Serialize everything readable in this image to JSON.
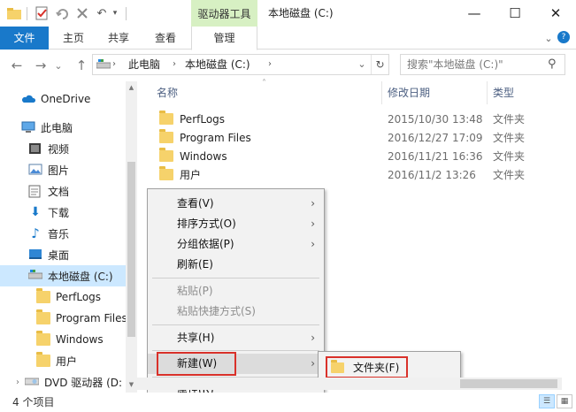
{
  "window": {
    "title": "本地磁盘 (C:)",
    "context_tab_group": "驱动器工具",
    "minimize_glyph": "—",
    "maximize_glyph": "☐",
    "close_glyph": "✕"
  },
  "quick_access": {
    "undo_glyph": "↶",
    "more_glyph": "▾"
  },
  "ribbon": {
    "tabs": [
      "文件",
      "主页",
      "共享",
      "查看",
      "管理"
    ],
    "collapse_glyph": "⌄",
    "help_glyph": "?"
  },
  "address_bar": {
    "back_glyph": "←",
    "forward_glyph": "→",
    "recent_glyph": "⌄",
    "up_glyph": "↑",
    "crumbs": [
      "此电脑",
      "本地磁盘 (C:)"
    ],
    "crumb_sep": "›",
    "dropdown_glyph": "⌄",
    "refresh_glyph": "↻",
    "search_placeholder": "搜索\"本地磁盘 (C:)\"",
    "search_glyph": "⚲"
  },
  "nav_pane": {
    "items": [
      {
        "label": "OneDrive",
        "icon": "onedrive-icon"
      },
      {
        "label": "此电脑",
        "icon": "pc-icon"
      },
      {
        "label": "视频",
        "icon": "video-icon"
      },
      {
        "label": "图片",
        "icon": "pictures-icon"
      },
      {
        "label": "文档",
        "icon": "documents-icon"
      },
      {
        "label": "下载",
        "icon": "download-icon"
      },
      {
        "label": "音乐",
        "icon": "music-icon"
      },
      {
        "label": "桌面",
        "icon": "desktop-icon"
      },
      {
        "label": "本地磁盘 (C:)",
        "icon": "drive-icon"
      },
      {
        "label": "PerfLogs",
        "icon": "folder-icon"
      },
      {
        "label": "Program Files",
        "icon": "folder-icon"
      },
      {
        "label": "Windows",
        "icon": "folder-icon"
      },
      {
        "label": "用户",
        "icon": "folder-icon"
      },
      {
        "label": "DVD 驱动器 (D:",
        "icon": "dvd-icon"
      }
    ],
    "expand_glyph": "›",
    "music_glyph": "♪",
    "download_glyph": "⬇"
  },
  "file_list": {
    "columns": [
      "名称",
      "修改日期",
      "类型"
    ],
    "sort_glyph": "˄",
    "rows": [
      {
        "name": "PerfLogs",
        "date": "2015/10/30 13:48",
        "type": "文件夹"
      },
      {
        "name": "Program Files",
        "date": "2016/12/27 17:09",
        "type": "文件夹"
      },
      {
        "name": "Windows",
        "date": "2016/11/21 16:36",
        "type": "文件夹"
      },
      {
        "name": "用户",
        "date": "2016/11/2 13:26",
        "type": "文件夹"
      }
    ]
  },
  "context_menu": {
    "submenu_glyph": "›",
    "items": [
      {
        "label": "查看(V)"
      },
      {
        "label": "排序方式(O)"
      },
      {
        "label": "分组依据(P)"
      },
      {
        "label": "刷新(E)"
      },
      {
        "label": "粘贴(P)"
      },
      {
        "label": "粘贴快捷方式(S)"
      },
      {
        "label": "共享(H)"
      },
      {
        "label": "新建(W)"
      },
      {
        "label": "属性(R)"
      }
    ]
  },
  "submenu_new": {
    "items": [
      {
        "label": "文件夹(F)"
      }
    ]
  },
  "scrollbars": {
    "up_glyph": "▲",
    "down_glyph": "▼"
  },
  "status_bar": {
    "item_count": "4 个项目",
    "details_glyph": "☰",
    "icons_glyph": "▦"
  },
  "colors": {
    "accent": "#1979ca",
    "context_tab_bg": "#d7f0c3",
    "selection": "#cce8ff",
    "highlight_box": "#d9312a"
  }
}
